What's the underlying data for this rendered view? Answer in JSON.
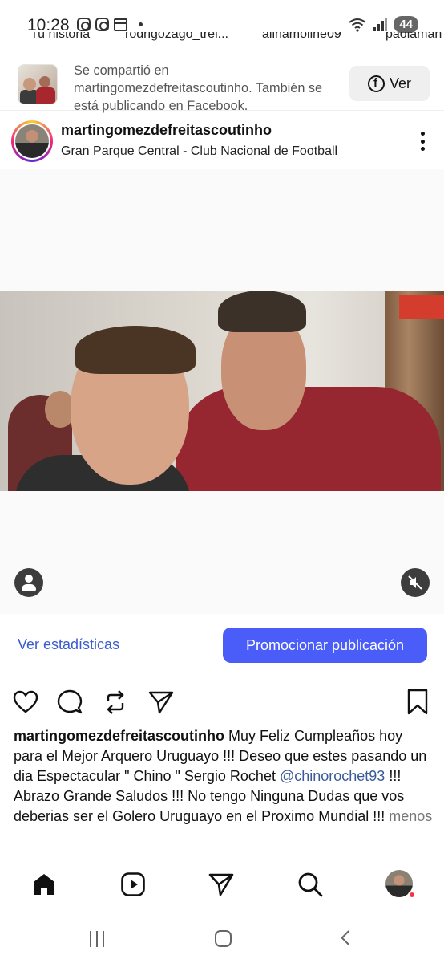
{
  "status_bar": {
    "time": "10:28",
    "battery": "44"
  },
  "stories": [
    "Tu historia",
    "rodrigozago_trei...",
    "alinamoline09",
    "paolaman"
  ],
  "shared_banner": {
    "text": "Se compartió en martingomezdefreitascoutinho. También se está publicando en Facebook.",
    "button_label": "Ver"
  },
  "post": {
    "username": "martingomezdefreitascoutinho",
    "location": "Gran Parque Central - Club Nacional de Football"
  },
  "insights": {
    "stats_label": "Ver estadísticas",
    "promote_label": "Promocionar publicación"
  },
  "caption": {
    "username": "martingomezdefreitascoutinho",
    "text_before": " Muy Feliz Cumpleaños hoy para el Mejor Arquero Uruguayo !!! Deseo que estes pasando un dia Espectacular \" Chino \" Sergio Rochet ",
    "mention": "@chinorochet93",
    "text_after": " !!! Abrazo Grande Saludos !!! No tengo Ninguna Dudas que vos deberias ser el Golero Uruguayo en el Proximo Mundial !!! ",
    "less_label": "menos"
  },
  "colors": {
    "accent": "#4a5df9",
    "link": "#3a5ccc",
    "mention": "#3a5a96"
  }
}
